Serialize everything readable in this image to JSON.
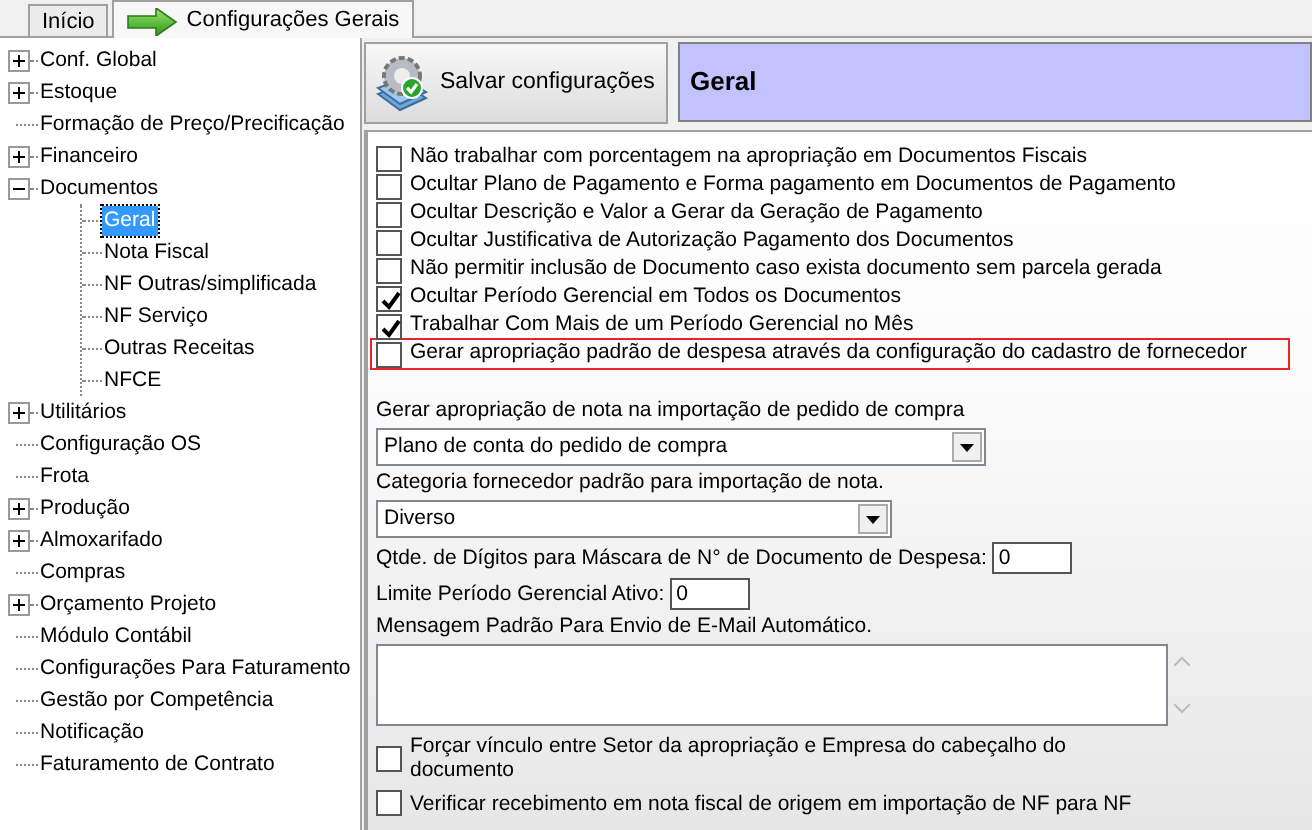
{
  "tabs": [
    {
      "label": "Início",
      "selected": false
    },
    {
      "label": "Configurações Gerais",
      "selected": true
    }
  ],
  "tree": [
    {
      "label": "Conf. Global",
      "expanded": false,
      "selected": false
    },
    {
      "label": "Estoque",
      "expanded": false,
      "selected": false
    },
    {
      "label": "Formação de Preço/Precificação",
      "selected": false
    },
    {
      "label": "Financeiro",
      "expanded": false,
      "selected": false
    },
    {
      "label": "Documentos",
      "expanded": true,
      "selected": false,
      "children": [
        {
          "label": "Geral",
          "selected": true
        },
        {
          "label": "Nota Fiscal",
          "selected": false
        },
        {
          "label": "NF Outras/simplificada",
          "selected": false
        },
        {
          "label": "NF Serviço",
          "selected": false
        },
        {
          "label": "Outras Receitas",
          "selected": false
        },
        {
          "label": "NFCE",
          "selected": false
        }
      ]
    },
    {
      "label": "Utilitários",
      "expanded": false,
      "selected": false
    },
    {
      "label": "Configuração OS",
      "selected": false
    },
    {
      "label": "Frota",
      "selected": false
    },
    {
      "label": "Produção",
      "expanded": false,
      "selected": false
    },
    {
      "label": "Almoxarifado",
      "expanded": false,
      "selected": false
    },
    {
      "label": "Compras",
      "selected": false
    },
    {
      "label": "Orçamento Projeto",
      "expanded": false,
      "selected": false
    },
    {
      "label": "Módulo Contábil",
      "selected": false
    },
    {
      "label": "Configurações Para Faturamento",
      "selected": false
    },
    {
      "label": "Gestão por Competência",
      "selected": false
    },
    {
      "label": "Notificação",
      "selected": false
    },
    {
      "label": "Faturamento de Contrato",
      "selected": false
    }
  ],
  "save_button": "Salvar configurações",
  "section_title": "Geral",
  "options": [
    {
      "label": "Não trabalhar com porcentagem na apropriação em Documentos Fiscais",
      "checked": false,
      "highlighted": false
    },
    {
      "label": "Ocultar Plano de Pagamento e Forma pagamento em Documentos de  Pagamento",
      "checked": false,
      "highlighted": false
    },
    {
      "label": "Ocultar Descrição e Valor a Gerar da Geração de Pagamento",
      "checked": false,
      "highlighted": false
    },
    {
      "label": "Ocultar Justificativa de Autorização Pagamento dos Documentos",
      "checked": false,
      "highlighted": false
    },
    {
      "label": "Não permitir inclusão de Documento caso exista documento sem parcela gerada",
      "checked": false,
      "highlighted": false
    },
    {
      "label": "Ocultar Período Gerencial em Todos os Documentos",
      "checked": true,
      "highlighted": false
    },
    {
      "label": "Trabalhar Com Mais de um Período Gerencial no Mês",
      "checked": true,
      "highlighted": false
    },
    {
      "label": "Gerar apropriação padrão de despesa através da configuração do cadastro de fornecedor",
      "checked": false,
      "highlighted": true
    }
  ],
  "fields": [
    {
      "kind": "select",
      "label": "Gerar apropriação de nota na importação de pedido de compra",
      "value": "Plano de conta do pedido de compra"
    },
    {
      "kind": "select",
      "label": "Categoria fornecedor padrão para  importação de nota.",
      "value": "Diverso"
    },
    {
      "kind": "number",
      "label": "Qtde. de Dígitos para Máscara de N° de Documento de Despesa:",
      "value": "0"
    },
    {
      "kind": "number",
      "label": "Limite Período Gerencial Ativo:",
      "value": "0"
    },
    {
      "kind": "textarea",
      "label": "Mensagem Padrão Para  Envio de E-Mail Automático."
    }
  ],
  "bottom_options": [
    {
      "label": "Forçar vínculo entre Setor da apropriação e Empresa do cabeçalho do documento",
      "checked": false
    },
    {
      "label": "Verificar recebimento em nota fiscal de origem em importação de NF para NF",
      "checked": false
    }
  ]
}
